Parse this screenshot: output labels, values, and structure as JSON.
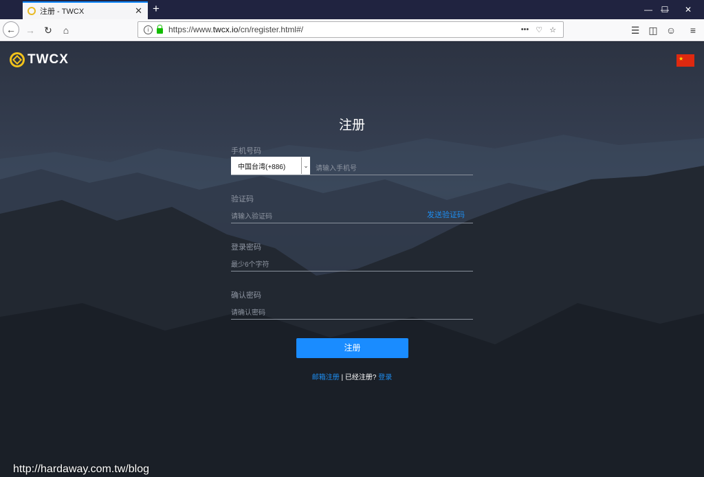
{
  "browser": {
    "tab_title": "注册 - TWCX",
    "close_tab": "✕",
    "new_tab": "+",
    "url_prefix": "https://www.",
    "url_domain": "twcx.io",
    "url_path": "/cn/register.html#/"
  },
  "header": {
    "logo_text": "TWCX"
  },
  "form": {
    "title": "注册",
    "phone_label": "手机号码",
    "country_value": "中国台湾(+886)",
    "phone_placeholder": "请输入手机号",
    "code_label": "验证码",
    "code_placeholder": "请输入验证码",
    "send_code": "发送验证码",
    "password_label": "登录密码",
    "password_placeholder": "最少6个字符",
    "confirm_label": "确认密码",
    "confirm_placeholder": "请确认密码",
    "submit_label": "注册"
  },
  "footer": {
    "email_register": "邮箱注册",
    "separator": " | ",
    "already": "已经注册?",
    "login": "登录"
  },
  "watermark": "http://hardaway.com.tw/blog"
}
